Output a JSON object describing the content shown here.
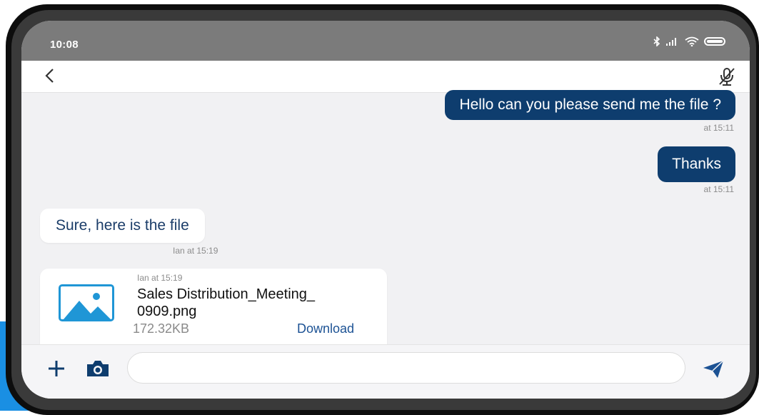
{
  "status_bar": {
    "time": "10:08",
    "icons": [
      "bluetooth-icon",
      "signal-icon",
      "wifi-icon",
      "battery-icon"
    ]
  },
  "header": {
    "back_icon": "chevron-left-icon",
    "mic_icon": "mic-off-icon"
  },
  "messages": [
    {
      "direction": "outgoing",
      "text": "Hello can you please send me the file ?",
      "timestamp": "at 15:11"
    },
    {
      "direction": "outgoing",
      "text": "Thanks",
      "timestamp": "at 15:11"
    },
    {
      "direction": "incoming",
      "text": "Sure, here is the file",
      "timestamp": "Ian at 15:19"
    }
  ],
  "file_message": {
    "sender_time": "Ian at 15:19",
    "filename_line1": "Sales Distribution_Meeting_",
    "filename_line2": "0909.png",
    "size": "172.32KB",
    "download_label": "Download",
    "icon": "image-file-icon"
  },
  "composer": {
    "placeholder": "",
    "icons": [
      "plus-icon",
      "camera-icon",
      "send-icon"
    ]
  },
  "colors": {
    "outgoing_bubble": "#0e3d6e",
    "incoming_text": "#1b3d69",
    "link": "#1c5294",
    "status_bar": "#7b7b7b",
    "background": "#f1f1f3",
    "image_icon": "#1f96d6"
  }
}
